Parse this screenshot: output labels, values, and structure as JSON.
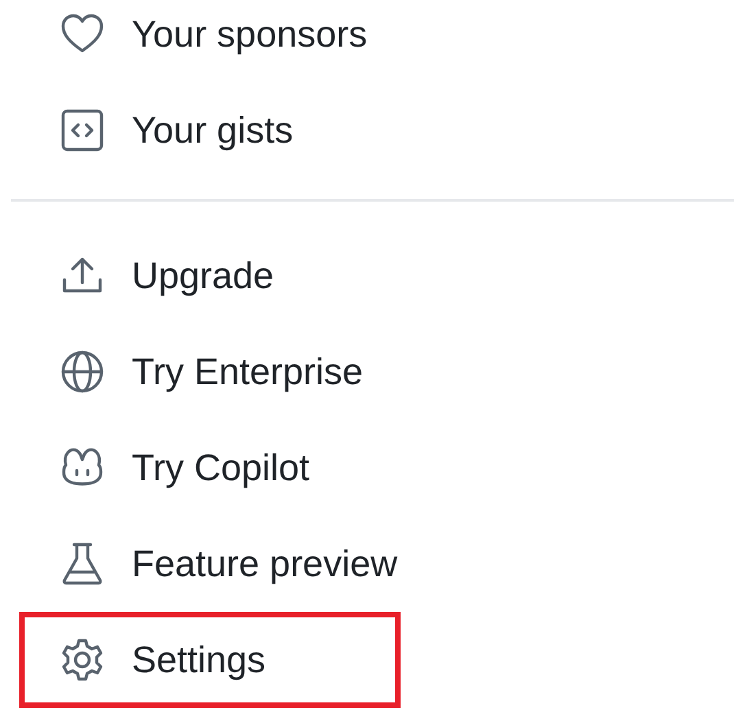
{
  "sections": [
    {
      "items": [
        {
          "label": "Your sponsors",
          "highlighted": false
        },
        {
          "label": "Your gists",
          "highlighted": false
        }
      ]
    },
    {
      "items": [
        {
          "label": "Upgrade",
          "highlighted": false
        },
        {
          "label": "Try Enterprise",
          "highlighted": false
        },
        {
          "label": "Try Copilot",
          "highlighted": false
        },
        {
          "label": "Feature preview",
          "highlighted": false
        },
        {
          "label": "Settings",
          "highlighted": true
        }
      ]
    }
  ]
}
